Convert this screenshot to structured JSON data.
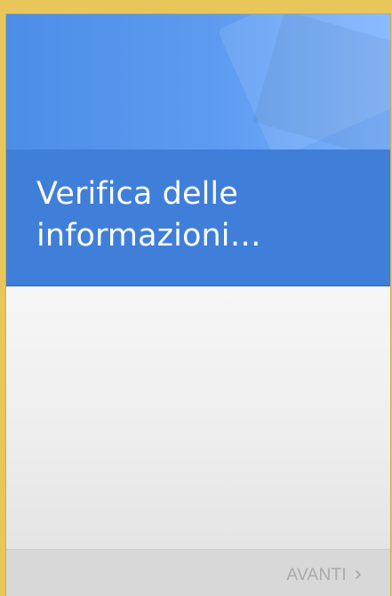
{
  "screen": {
    "title": "Verifica delle\ninformazioni…"
  },
  "footer": {
    "next_label": "AVANTI"
  },
  "icons": {
    "next": "chevron-right-icon"
  },
  "colors": {
    "hero_blue": "#4b8de8",
    "title_band_blue": "#3f7fda",
    "title_text": "#ffffff",
    "disabled_text": "#aaaaaa",
    "footer_background": "#d8d8d8",
    "outer_frame": "#e9c65a"
  }
}
